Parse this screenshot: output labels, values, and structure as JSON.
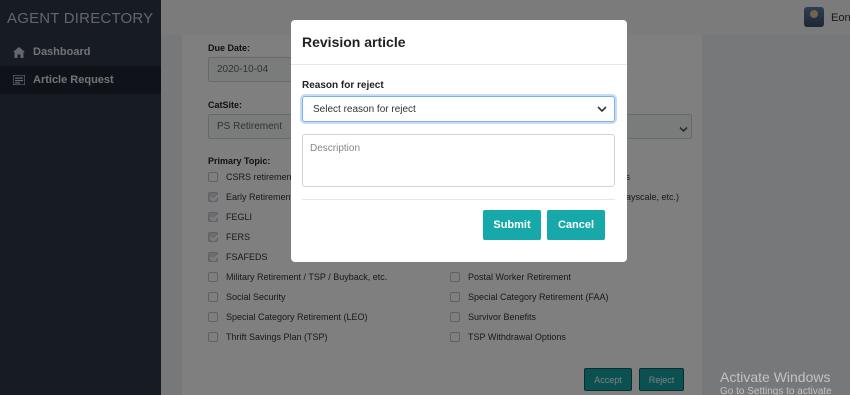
{
  "sidebar": {
    "brand": "AGENT DIRECTORY",
    "items": [
      {
        "label": "Dashboard",
        "icon": "home-icon"
      },
      {
        "label": "Article Request",
        "icon": "list-icon"
      }
    ]
  },
  "topbar": {
    "username": "Eon"
  },
  "form": {
    "due_date_label": "Due Date:",
    "due_date_value": "2020-10-04",
    "catsite_label": "CatSite:",
    "catsite_value": "PS Retirement",
    "primary_topic_label": "Primary Topic:",
    "topics_left": [
      {
        "label": "CSRS retirement",
        "checked": false
      },
      {
        "label": "Early Retirement",
        "checked": true
      },
      {
        "label": "FEGLI",
        "checked": true
      },
      {
        "label": "FERS",
        "checked": true
      },
      {
        "label": "FSAFEDS",
        "checked": true
      },
      {
        "label": "Military Retirement / TSP / Buyback, etc.",
        "checked": false
      },
      {
        "label": "Social Security",
        "checked": false
      },
      {
        "label": "Special Category Retirement (LEO)",
        "checked": false
      },
      {
        "label": "Thrift Savings Plan (TSP)",
        "checked": false
      }
    ],
    "topics_right": [
      {
        "label": "its",
        "checked": false
      },
      {
        "label": "aayscale, etc.)",
        "checked": false
      },
      {
        "label": "Postal Worker Retirement",
        "checked": false
      },
      {
        "label": "Special Category Retirement (FAA)",
        "checked": false
      },
      {
        "label": "Survivor Benefits",
        "checked": false
      },
      {
        "label": "TSP Withdrawal Options",
        "checked": false
      }
    ],
    "accept_label": "Accept",
    "reject_label": "Reject"
  },
  "modal": {
    "title": "Revision article",
    "reason_label": "Reason for reject",
    "reason_select_value": "Select reason for reject",
    "description_placeholder": "Description",
    "submit_label": "Submit",
    "cancel_label": "Cancel"
  },
  "watermark": {
    "line1": "Activate Windows",
    "line2": "Go to Settings to activate Windo"
  },
  "colors": {
    "sidebar": "#2d3748",
    "accent": "#17a9a9"
  }
}
